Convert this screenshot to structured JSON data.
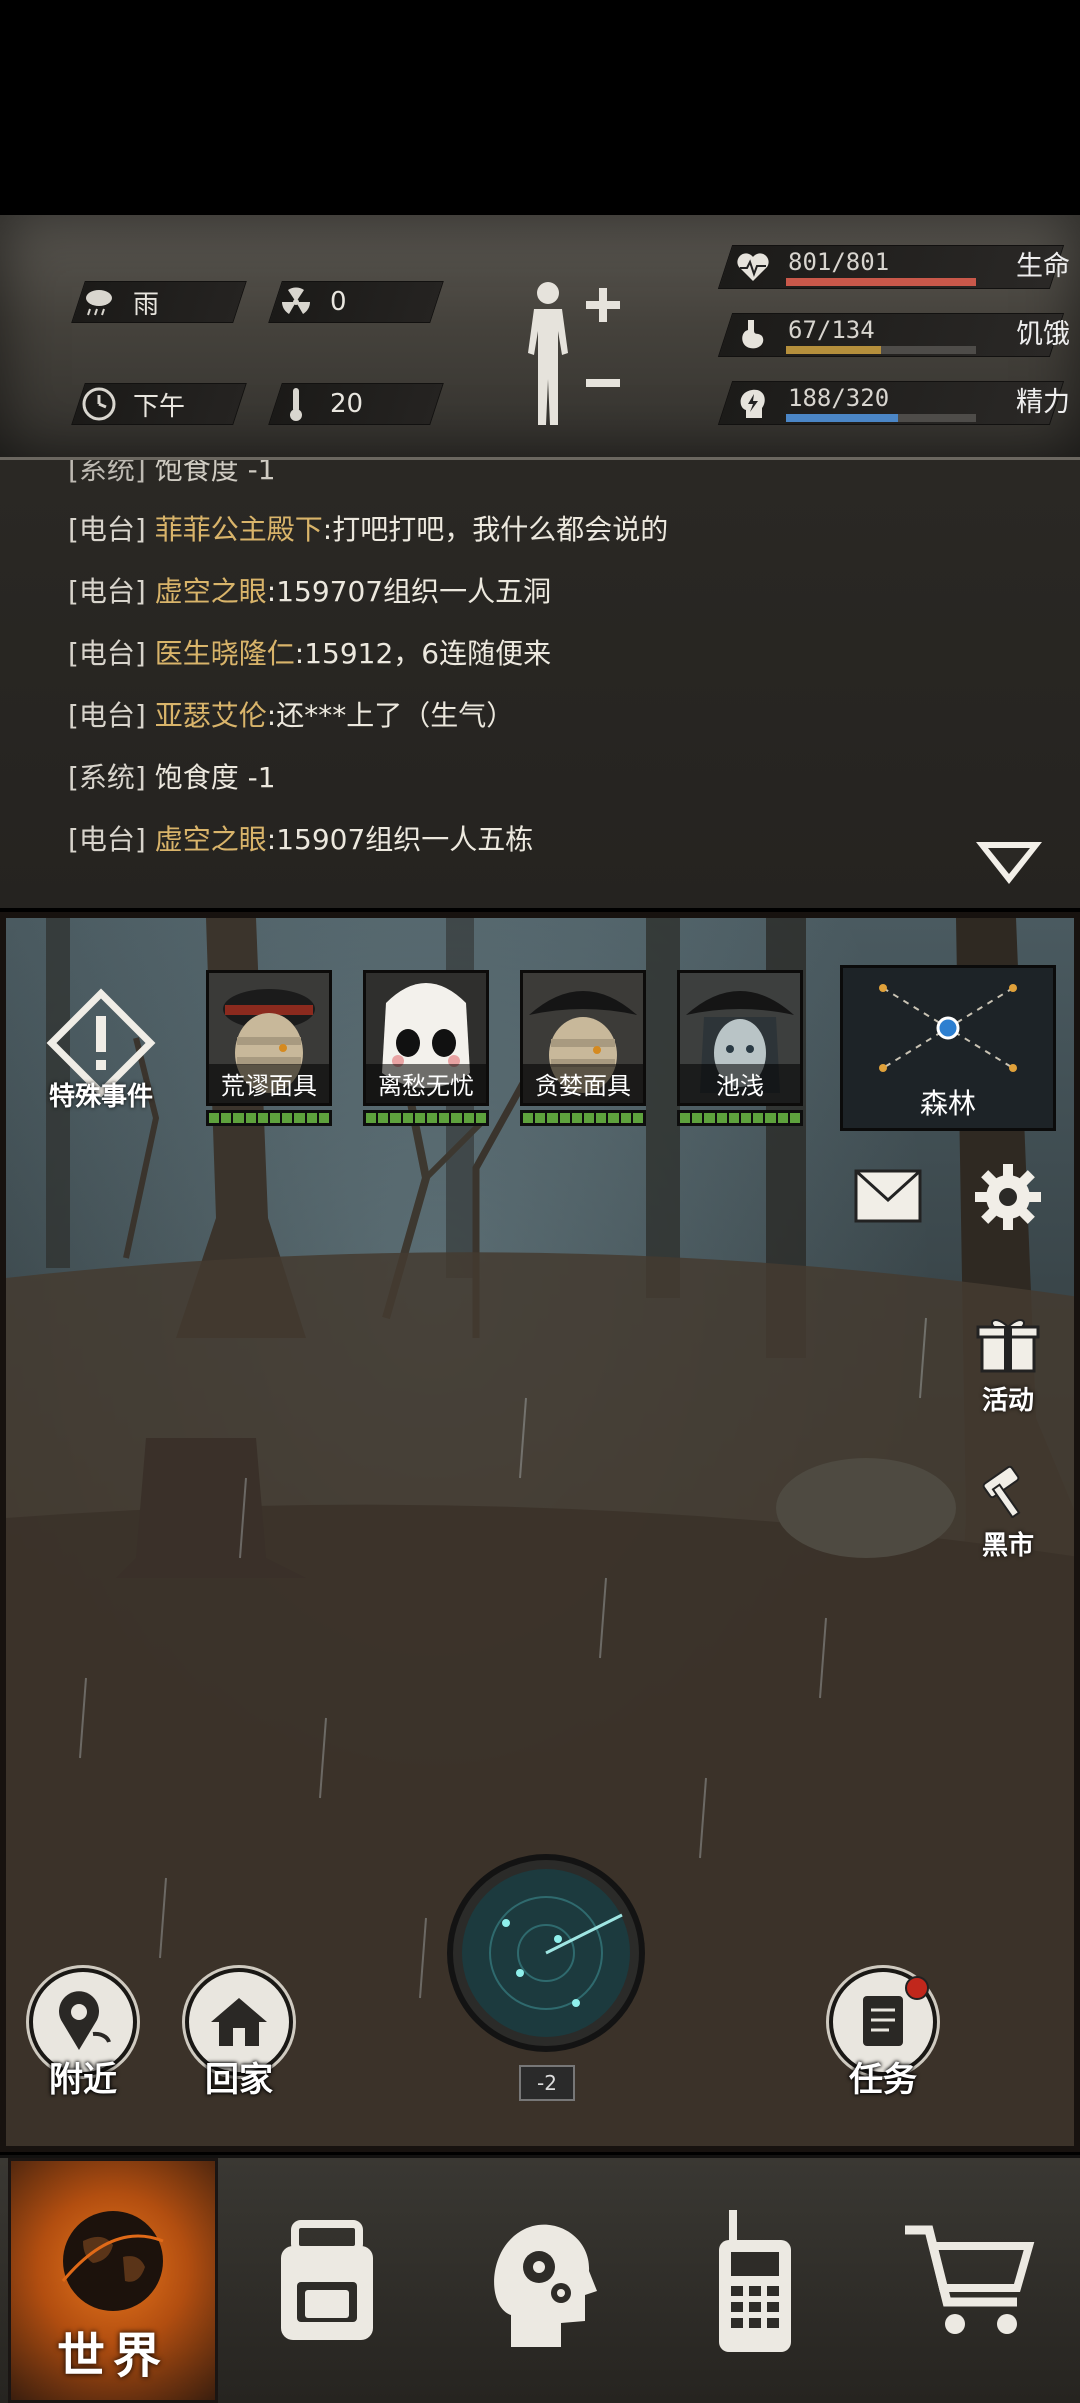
{
  "status": {
    "weather": "雨",
    "radiation": "0",
    "time_of_day": "下午",
    "temperature": "20",
    "life": {
      "label": "生命",
      "current": 801,
      "max": 801,
      "text": "801/801",
      "color": "#c9584a"
    },
    "hunger": {
      "label": "饥饿",
      "current": 67,
      "max": 134,
      "text": "67/134",
      "color": "#b58f3c"
    },
    "energy": {
      "label": "精力",
      "current": 188,
      "max": 320,
      "text": "188/320",
      "color": "#4b86c6"
    }
  },
  "chat": {
    "lines": [
      {
        "tag": "[系统]",
        "name": "",
        "msg": "饱食度 -1"
      },
      {
        "tag": "[电台]",
        "name": "菲菲公主殿下",
        "msg": ":打吧打吧，我什么都会说的"
      },
      {
        "tag": "[电台]",
        "name": "虚空之眼",
        "msg": ":159707组织一人五洞"
      },
      {
        "tag": "[电台]",
        "name": "医生晓隆仁",
        "msg": ":15912，6连随便来"
      },
      {
        "tag": "[电台]",
        "name": "亚瑟艾伦",
        "msg": ":还***上了（生气）"
      },
      {
        "tag": "[系统]",
        "name": "",
        "msg": "饱食度 -1"
      },
      {
        "tag": "[电台]",
        "name": "虚空之眼",
        "msg": ":15907组织一人五栋"
      }
    ]
  },
  "scene": {
    "special_event": "特殊事件",
    "portraits": [
      {
        "name": "荒谬面具",
        "hp": 1.0
      },
      {
        "name": "离愁无忧",
        "hp": 1.0
      },
      {
        "name": "贪婪面具",
        "hp": 1.0
      },
      {
        "name": "池浅",
        "hp": 1.0
      }
    ],
    "location": "森林",
    "side": {
      "activity": "活动",
      "black_market": "黑市"
    },
    "nearby": "附近",
    "home": "回家",
    "tasks": "任务",
    "radar_level": "-2"
  },
  "nav": {
    "world": "世界",
    "items": [
      "backpack-icon",
      "skills-head-icon",
      "radio-icon",
      "shop-cart-icon"
    ]
  }
}
